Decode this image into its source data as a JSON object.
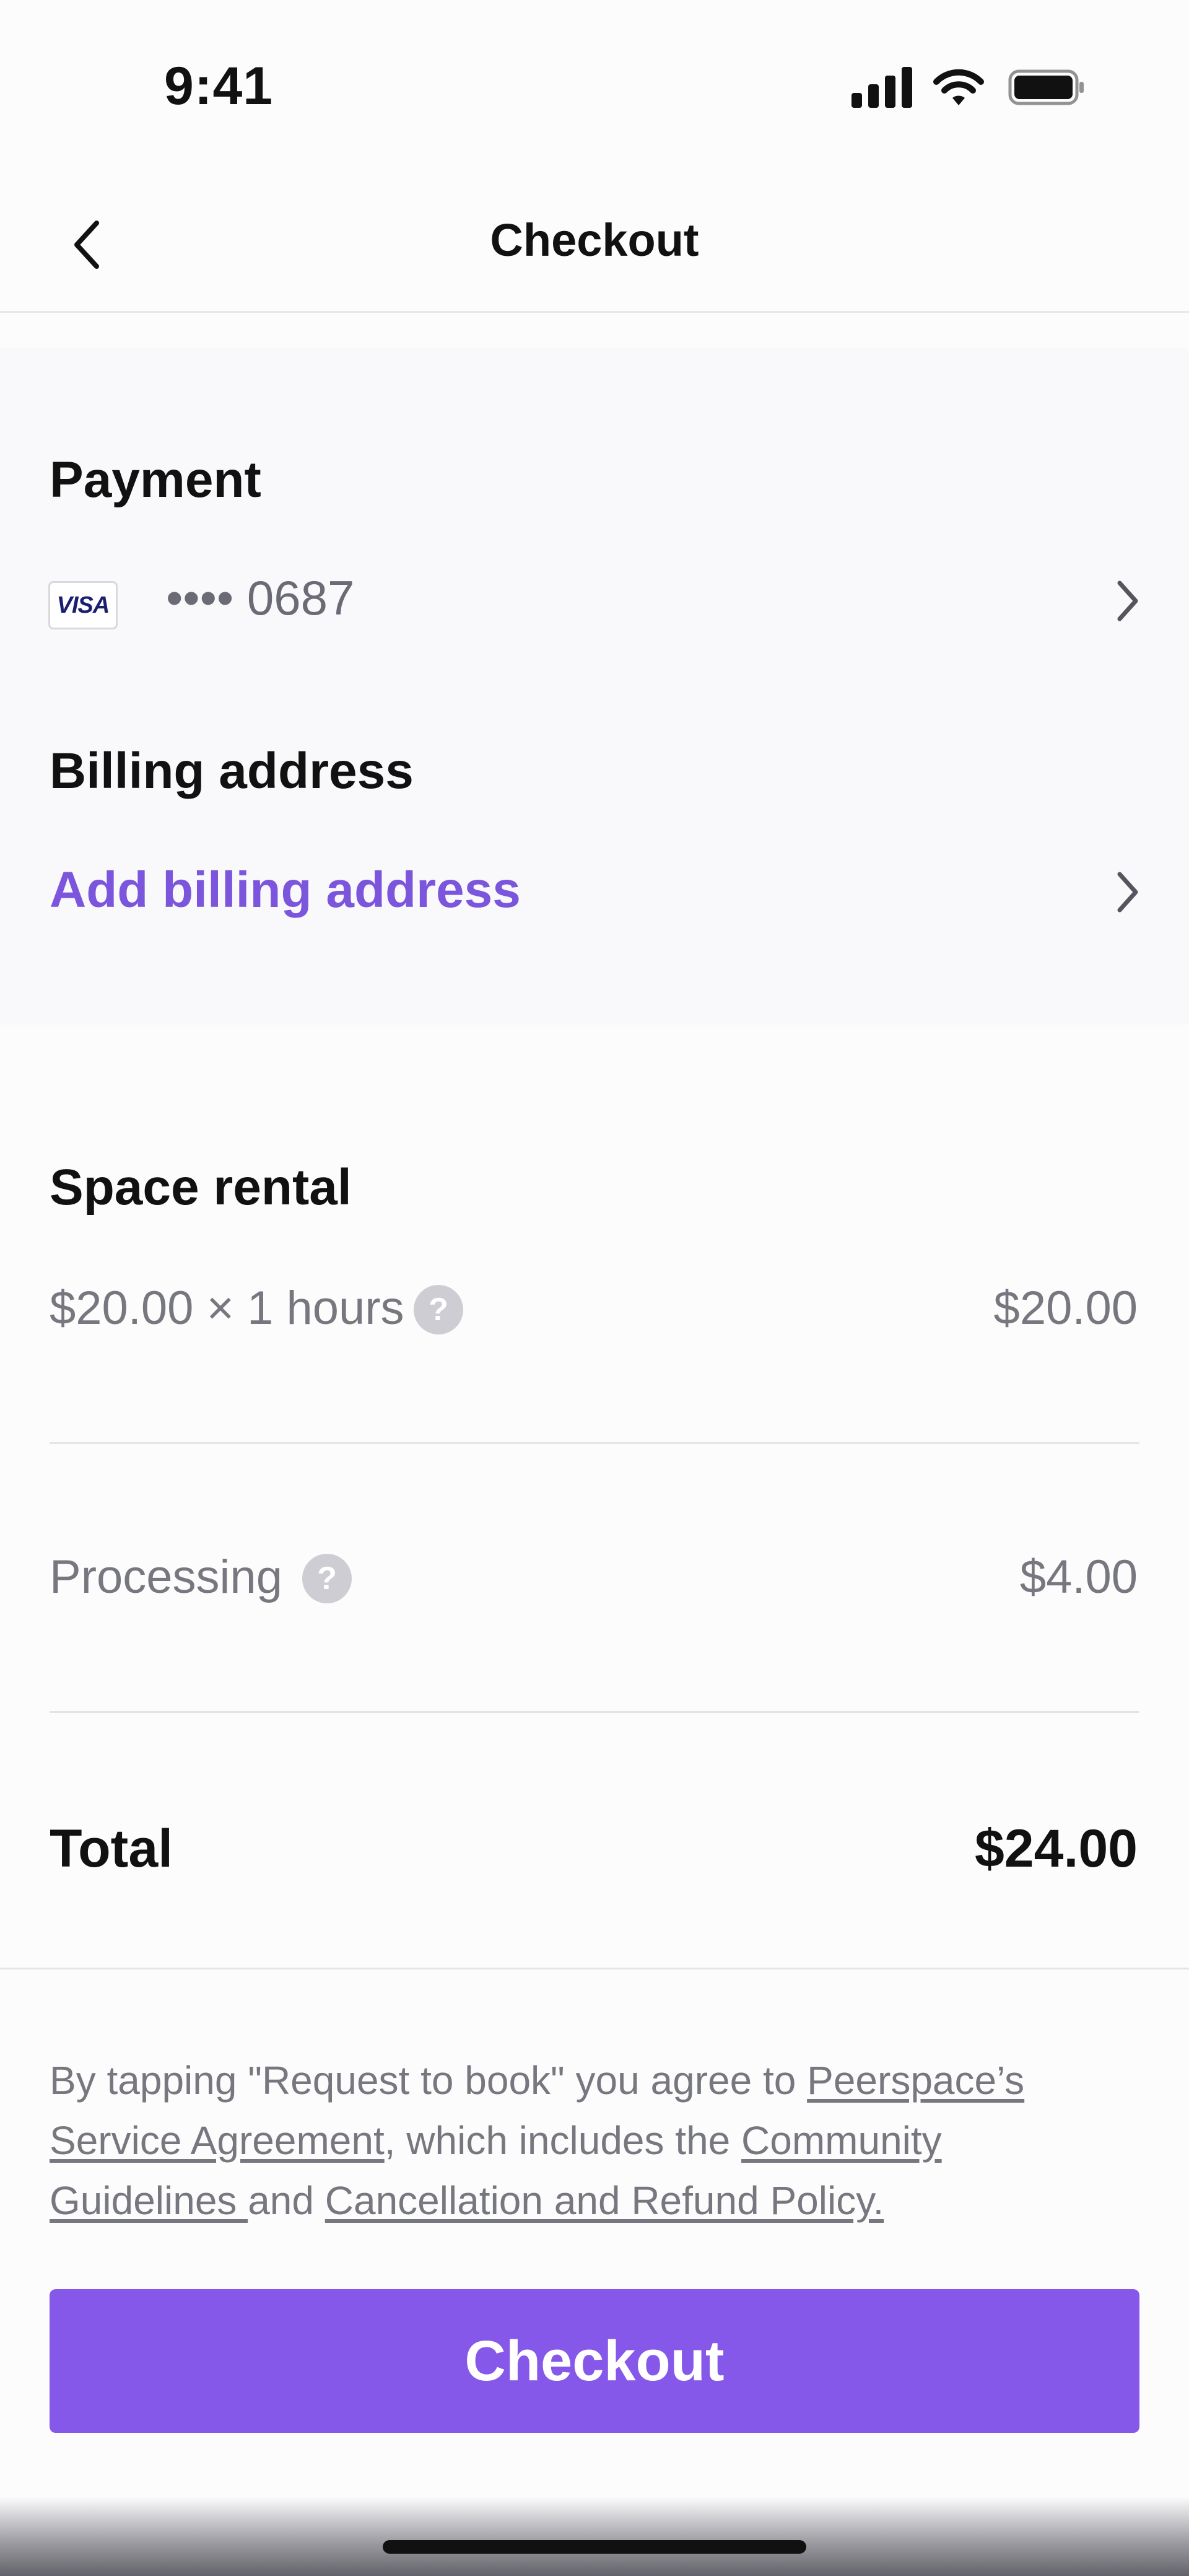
{
  "status_bar": {
    "time": "9:41"
  },
  "header": {
    "title": "Checkout"
  },
  "payment": {
    "title": "Payment",
    "card_brand": "VISA",
    "card_number": "•••• 0687"
  },
  "billing": {
    "title": "Billing address",
    "link_label": "Add billing address"
  },
  "rental": {
    "title": "Space rental",
    "lines": [
      {
        "label": "$20.00 × 1 hours",
        "value": "$20.00"
      },
      {
        "label": "Processing",
        "value": "$4.00"
      }
    ],
    "help_glyph": "?",
    "total_label": "Total",
    "total_value": "$24.00"
  },
  "terms": {
    "prefix": "By tapping \"Request to book\" you agree to ",
    "link1": "Peerspace’s Service Agreement",
    "middle": ", which includes the ",
    "link2": "Community Guidelines ",
    "and": "and ",
    "link3": "Cancellation and Refund Policy."
  },
  "checkout_button": {
    "label": "Checkout"
  },
  "colors": {
    "accent": "#8658ea",
    "link": "#7b55dc",
    "muted_text": "#77777f"
  },
  "icons": [
    "back-chevron-icon",
    "signal-icon",
    "wifi-icon",
    "battery-icon",
    "chevron-right-icon",
    "help-icon"
  ]
}
